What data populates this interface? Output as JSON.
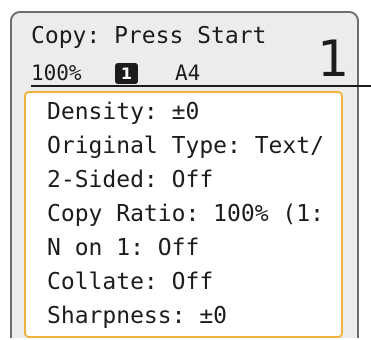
{
  "status": {
    "message": "Copy: Press Start"
  },
  "info": {
    "copy_ratio": "100%",
    "paper_source_badge": "1",
    "paper_size": "A4",
    "copy_count": "1"
  },
  "settings": {
    "items": [
      {
        "label": "Density: ±0"
      },
      {
        "label": "Original Type: Text/"
      },
      {
        "label": "2-Sided: Off"
      },
      {
        "label": "Copy Ratio: 100% (1:"
      },
      {
        "label": "N on 1: Off"
      },
      {
        "label": "Collate: Off"
      },
      {
        "label": "Sharpness: ±0"
      }
    ],
    "highlight_color": "#f2b23e"
  }
}
